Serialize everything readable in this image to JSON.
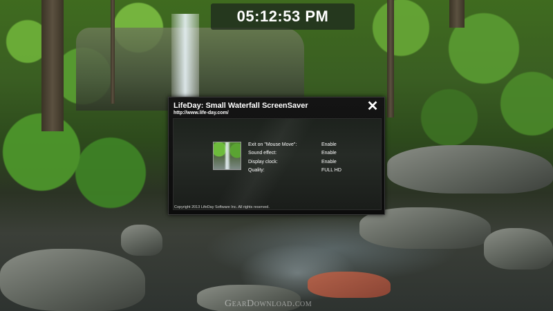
{
  "clock": {
    "time": "05:12:53 PM"
  },
  "dialog": {
    "title": "LifeDay: Small Waterfall ScreenSaver",
    "url": "http://www.life-day.com/",
    "close_icon": "close-icon",
    "close_glyph": "✕",
    "settings": [
      {
        "label": "Exit on \"Mouse Move\":",
        "value": "Enable"
      },
      {
        "label": "Sound effect:",
        "value": "Enable"
      },
      {
        "label": "Display clock:",
        "value": "Enable"
      },
      {
        "label": "Quality:",
        "value": "FULL HD"
      }
    ],
    "copyright": "Copyright 2013 LifeDay Software Inc. All rights reserved."
  },
  "watermark": {
    "text": "GearDownload.com"
  },
  "colors": {
    "dialog_bg": "#111111",
    "text": "#ffffff"
  }
}
